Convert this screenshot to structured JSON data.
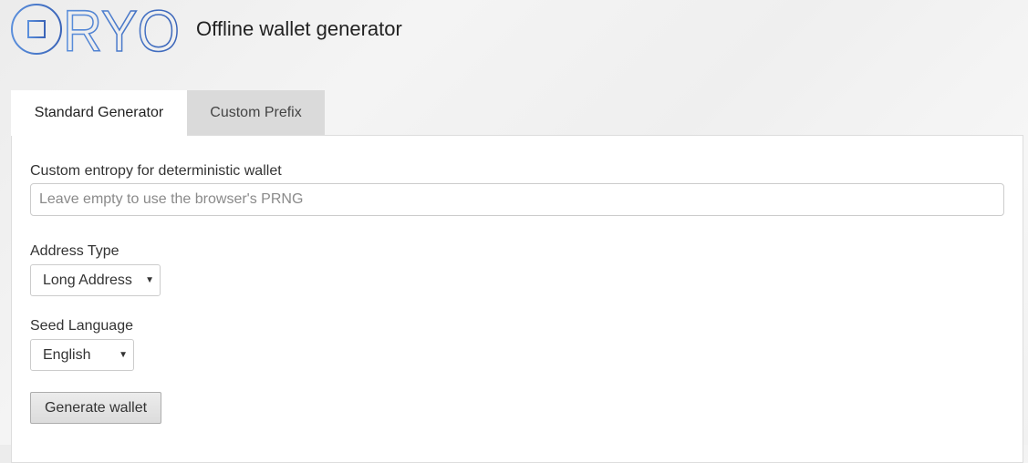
{
  "header": {
    "logo_text": "RYO",
    "title": "Offline wallet generator"
  },
  "tabs": [
    {
      "label": "Standard Generator",
      "active": true
    },
    {
      "label": "Custom Prefix",
      "active": false
    }
  ],
  "form": {
    "entropy": {
      "label": "Custom entropy for deterministic wallet",
      "value": "",
      "placeholder": "Leave empty to use the browser's PRNG"
    },
    "address_type": {
      "label": "Address Type",
      "selected": "Long Address"
    },
    "seed_language": {
      "label": "Seed Language",
      "selected": "English"
    },
    "generate_label": "Generate wallet"
  },
  "colors": {
    "logo_blue": "#3f74c6",
    "tab_inactive": "#dadada",
    "panel_border": "#dddddd"
  },
  "icons": {
    "logo": "ryo-logo",
    "select_caret": "caret-down-icon"
  }
}
